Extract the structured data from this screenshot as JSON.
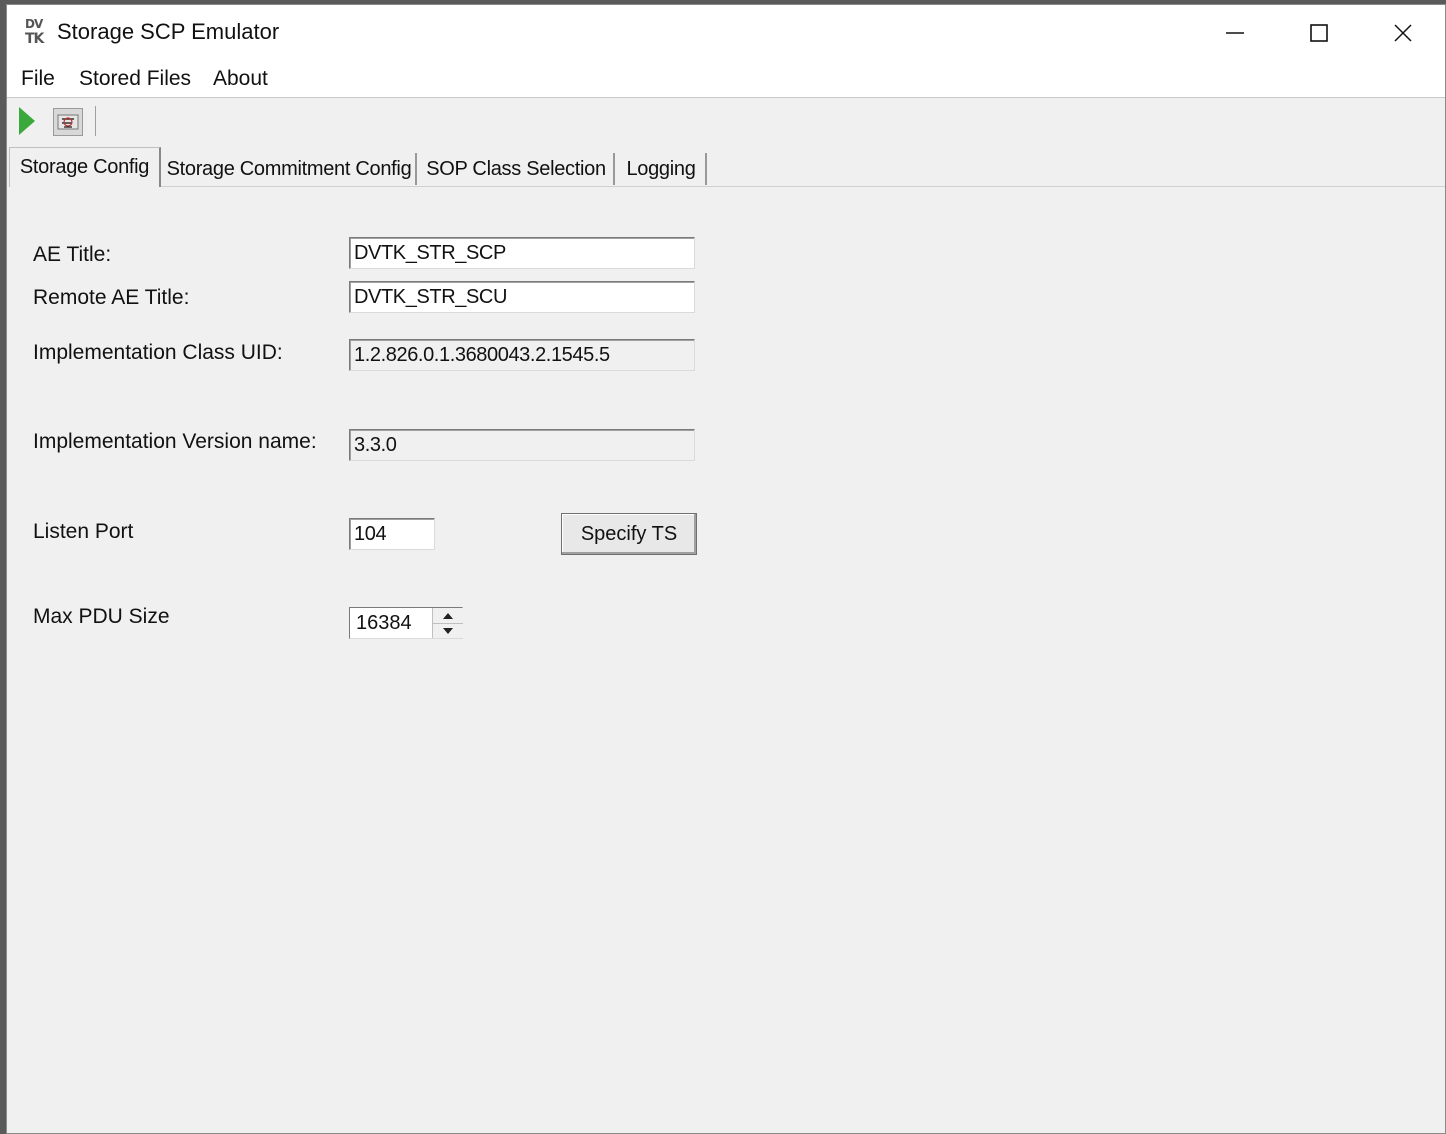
{
  "window": {
    "title": "Storage SCP Emulator"
  },
  "menu": {
    "items": [
      "File",
      "Stored Files",
      "About"
    ]
  },
  "toolbar": {
    "play_icon": "play-icon",
    "config_icon": "config-icon"
  },
  "tabs": [
    {
      "label": "Storage Config",
      "active": true
    },
    {
      "label": "Storage Commitment Config",
      "active": false
    },
    {
      "label": "SOP Class Selection",
      "active": false
    },
    {
      "label": "Logging",
      "active": false
    }
  ],
  "form": {
    "ae_title": {
      "label": "AE Title:",
      "value": "DVTK_STR_SCP"
    },
    "remote_ae_title": {
      "label": "Remote AE Title:",
      "value": "DVTK_STR_SCU"
    },
    "impl_class_uid": {
      "label": "Implementation Class UID:",
      "value": "1.2.826.0.1.3680043.2.1545.5"
    },
    "impl_version_name": {
      "label": "Implementation Version name:",
      "value": "3.3.0"
    },
    "listen_port": {
      "label": "Listen Port",
      "value": "104"
    },
    "specify_ts_button": "Specify TS",
    "max_pdu_size": {
      "label": "Max PDU Size",
      "value": "16384"
    }
  },
  "colors": {
    "play_green": "#3aa83a",
    "window_bg": "#f0f0f0"
  }
}
